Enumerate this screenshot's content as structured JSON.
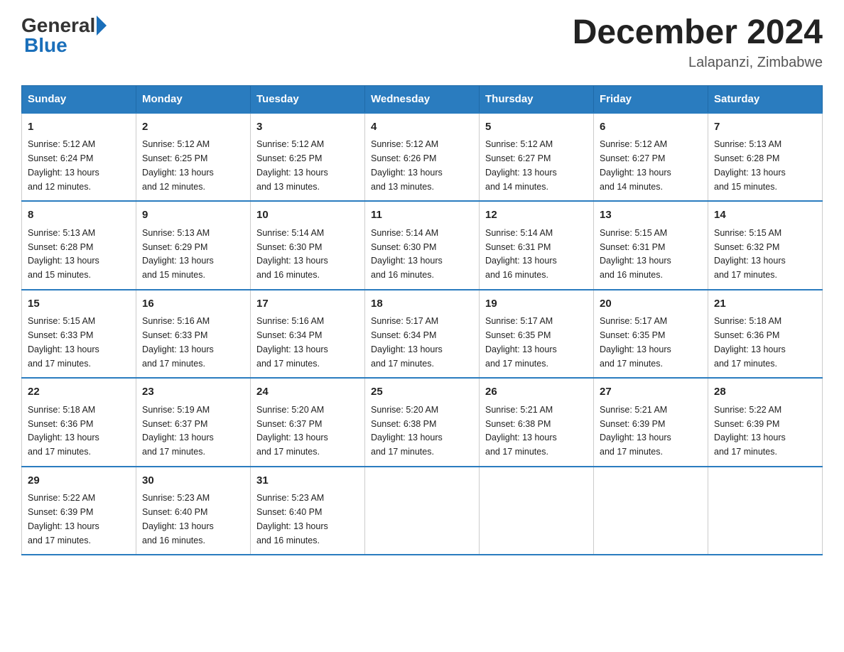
{
  "header": {
    "logo": {
      "general": "General",
      "blue": "Blue"
    },
    "title": "December 2024",
    "location": "Lalapanzi, Zimbabwe"
  },
  "weekdays": [
    "Sunday",
    "Monday",
    "Tuesday",
    "Wednesday",
    "Thursday",
    "Friday",
    "Saturday"
  ],
  "weeks": [
    [
      {
        "day": "1",
        "sunrise": "5:12 AM",
        "sunset": "6:24 PM",
        "daylight": "13 hours and 12 minutes."
      },
      {
        "day": "2",
        "sunrise": "5:12 AM",
        "sunset": "6:25 PM",
        "daylight": "13 hours and 12 minutes."
      },
      {
        "day": "3",
        "sunrise": "5:12 AM",
        "sunset": "6:25 PM",
        "daylight": "13 hours and 13 minutes."
      },
      {
        "day": "4",
        "sunrise": "5:12 AM",
        "sunset": "6:26 PM",
        "daylight": "13 hours and 13 minutes."
      },
      {
        "day": "5",
        "sunrise": "5:12 AM",
        "sunset": "6:27 PM",
        "daylight": "13 hours and 14 minutes."
      },
      {
        "day": "6",
        "sunrise": "5:12 AM",
        "sunset": "6:27 PM",
        "daylight": "13 hours and 14 minutes."
      },
      {
        "day": "7",
        "sunrise": "5:13 AM",
        "sunset": "6:28 PM",
        "daylight": "13 hours and 15 minutes."
      }
    ],
    [
      {
        "day": "8",
        "sunrise": "5:13 AM",
        "sunset": "6:28 PM",
        "daylight": "13 hours and 15 minutes."
      },
      {
        "day": "9",
        "sunrise": "5:13 AM",
        "sunset": "6:29 PM",
        "daylight": "13 hours and 15 minutes."
      },
      {
        "day": "10",
        "sunrise": "5:14 AM",
        "sunset": "6:30 PM",
        "daylight": "13 hours and 16 minutes."
      },
      {
        "day": "11",
        "sunrise": "5:14 AM",
        "sunset": "6:30 PM",
        "daylight": "13 hours and 16 minutes."
      },
      {
        "day": "12",
        "sunrise": "5:14 AM",
        "sunset": "6:31 PM",
        "daylight": "13 hours and 16 minutes."
      },
      {
        "day": "13",
        "sunrise": "5:15 AM",
        "sunset": "6:31 PM",
        "daylight": "13 hours and 16 minutes."
      },
      {
        "day": "14",
        "sunrise": "5:15 AM",
        "sunset": "6:32 PM",
        "daylight": "13 hours and 17 minutes."
      }
    ],
    [
      {
        "day": "15",
        "sunrise": "5:15 AM",
        "sunset": "6:33 PM",
        "daylight": "13 hours and 17 minutes."
      },
      {
        "day": "16",
        "sunrise": "5:16 AM",
        "sunset": "6:33 PM",
        "daylight": "13 hours and 17 minutes."
      },
      {
        "day": "17",
        "sunrise": "5:16 AM",
        "sunset": "6:34 PM",
        "daylight": "13 hours and 17 minutes."
      },
      {
        "day": "18",
        "sunrise": "5:17 AM",
        "sunset": "6:34 PM",
        "daylight": "13 hours and 17 minutes."
      },
      {
        "day": "19",
        "sunrise": "5:17 AM",
        "sunset": "6:35 PM",
        "daylight": "13 hours and 17 minutes."
      },
      {
        "day": "20",
        "sunrise": "5:17 AM",
        "sunset": "6:35 PM",
        "daylight": "13 hours and 17 minutes."
      },
      {
        "day": "21",
        "sunrise": "5:18 AM",
        "sunset": "6:36 PM",
        "daylight": "13 hours and 17 minutes."
      }
    ],
    [
      {
        "day": "22",
        "sunrise": "5:18 AM",
        "sunset": "6:36 PM",
        "daylight": "13 hours and 17 minutes."
      },
      {
        "day": "23",
        "sunrise": "5:19 AM",
        "sunset": "6:37 PM",
        "daylight": "13 hours and 17 minutes."
      },
      {
        "day": "24",
        "sunrise": "5:20 AM",
        "sunset": "6:37 PM",
        "daylight": "13 hours and 17 minutes."
      },
      {
        "day": "25",
        "sunrise": "5:20 AM",
        "sunset": "6:38 PM",
        "daylight": "13 hours and 17 minutes."
      },
      {
        "day": "26",
        "sunrise": "5:21 AM",
        "sunset": "6:38 PM",
        "daylight": "13 hours and 17 minutes."
      },
      {
        "day": "27",
        "sunrise": "5:21 AM",
        "sunset": "6:39 PM",
        "daylight": "13 hours and 17 minutes."
      },
      {
        "day": "28",
        "sunrise": "5:22 AM",
        "sunset": "6:39 PM",
        "daylight": "13 hours and 17 minutes."
      }
    ],
    [
      {
        "day": "29",
        "sunrise": "5:22 AM",
        "sunset": "6:39 PM",
        "daylight": "13 hours and 17 minutes."
      },
      {
        "day": "30",
        "sunrise": "5:23 AM",
        "sunset": "6:40 PM",
        "daylight": "13 hours and 16 minutes."
      },
      {
        "day": "31",
        "sunrise": "5:23 AM",
        "sunset": "6:40 PM",
        "daylight": "13 hours and 16 minutes."
      },
      null,
      null,
      null,
      null
    ]
  ],
  "labels": {
    "sunrise": "Sunrise:",
    "sunset": "Sunset:",
    "daylight": "Daylight:"
  }
}
